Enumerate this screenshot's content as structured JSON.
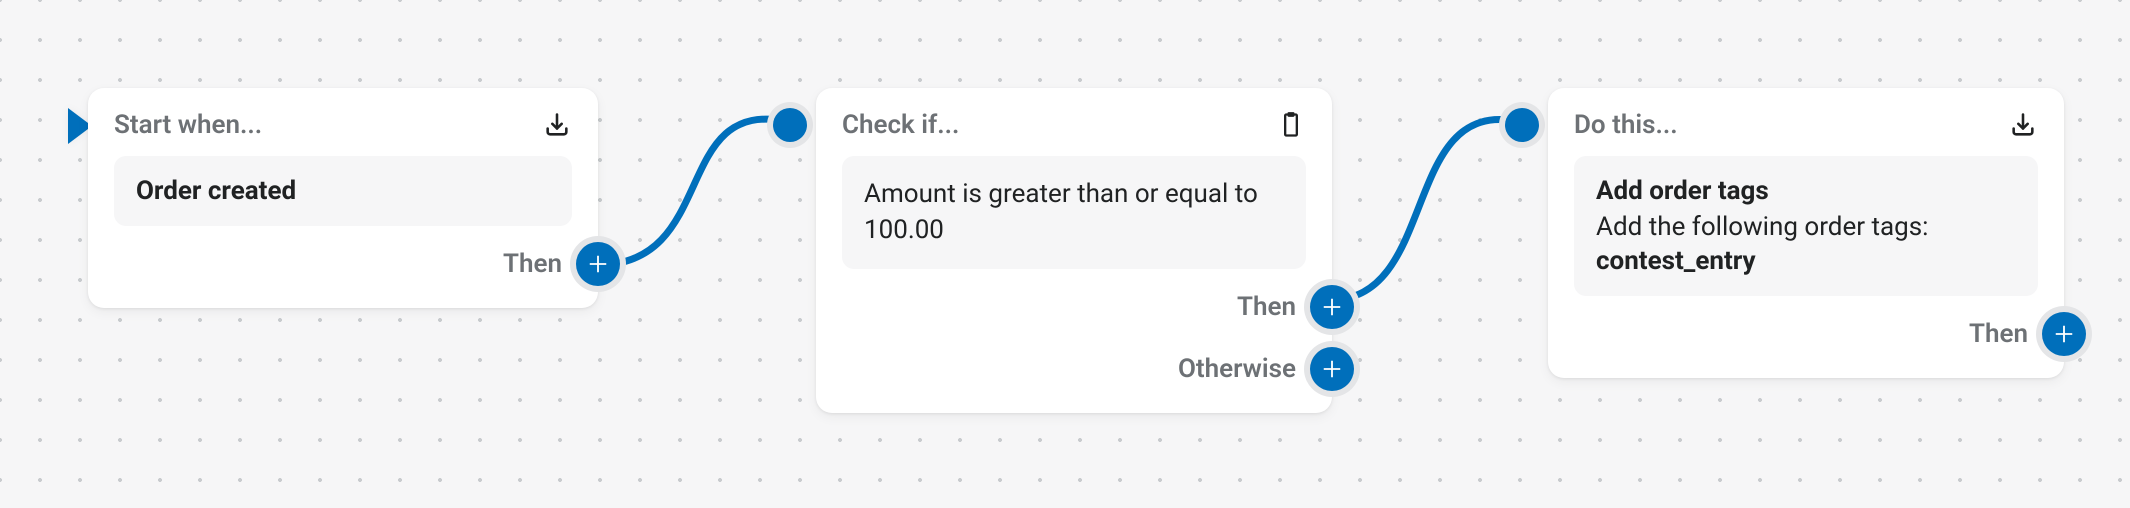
{
  "colors": {
    "accent": "#006fbb",
    "muted": "#6d7175",
    "bg": "#f6f6f7"
  },
  "nodes": {
    "trigger": {
      "header": "Start when...",
      "body_bold": "Order created",
      "then_label": "Then"
    },
    "condition": {
      "header": "Check if...",
      "body": "Amount is greater than or equal to 100.00",
      "then_label": "Then",
      "otherwise_label": "Otherwise"
    },
    "action": {
      "header": "Do this...",
      "body_bold": "Add order tags",
      "body_sub": "Add the following order tags:",
      "body_tag": "contest_entry",
      "then_label": "Then"
    }
  }
}
